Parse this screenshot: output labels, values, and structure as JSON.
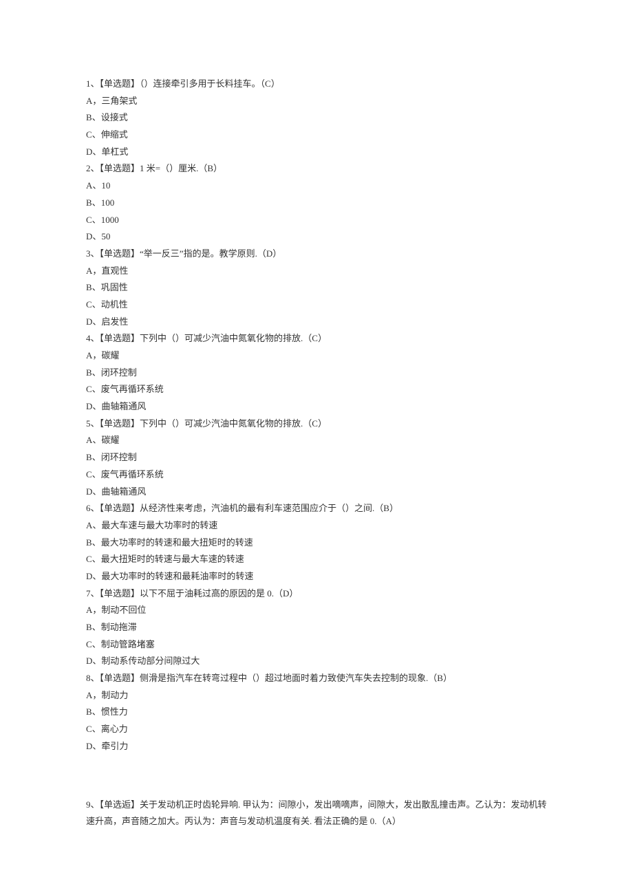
{
  "questions": [
    {
      "num": "1",
      "type": "【单选题】",
      "text": "（）连接牵引多用于长料挂车。",
      "answer": "（C）",
      "options": [
        {
          "label": "A",
          "sep": "，",
          "text": "三角架式"
        },
        {
          "label": "B",
          "sep": "、",
          "text": "设接式"
        },
        {
          "label": "C",
          "sep": "、",
          "text": "伸缩式"
        },
        {
          "label": "D",
          "sep": "、",
          "text": "单杠式"
        }
      ]
    },
    {
      "num": "2",
      "type": "【单选题】",
      "text": "1 米=（）厘米.",
      "answer": "（B）",
      "options": [
        {
          "label": "A",
          "sep": "、",
          "text": "10"
        },
        {
          "label": "B",
          "sep": "、",
          "text": "100"
        },
        {
          "label": "C",
          "sep": "、",
          "text": "1000"
        },
        {
          "label": "D",
          "sep": "、",
          "text": "50"
        }
      ]
    },
    {
      "num": "3",
      "type": "【单选题】",
      "text": "“举一反三”指的是。教学原则.",
      "answer": "（D）",
      "options": [
        {
          "label": "A",
          "sep": "，",
          "text": "直观性"
        },
        {
          "label": "B",
          "sep": "、",
          "text": "巩固性"
        },
        {
          "label": "C",
          "sep": "、",
          "text": "动机性"
        },
        {
          "label": "D",
          "sep": "、",
          "text": "启发性"
        }
      ]
    },
    {
      "num": "4",
      "type": "【单选题】",
      "text": "下列中（）可减少汽油中氮氧化物的排放.",
      "answer": "（C）",
      "options": [
        {
          "label": "A",
          "sep": "，",
          "text": "碳耀"
        },
        {
          "label": "B",
          "sep": "、",
          "text": "闭环控制"
        },
        {
          "label": "C",
          "sep": "、",
          "text": "废气再循环系统"
        },
        {
          "label": "D",
          "sep": "、",
          "text": "曲轴箱通风"
        }
      ]
    },
    {
      "num": "5",
      "type": "【单选题】",
      "text": "下列中（）可减少汽油中氮氧化物的排放.",
      "answer": "（C）",
      "options": [
        {
          "label": "A",
          "sep": "、",
          "text": "碳耀"
        },
        {
          "label": "B",
          "sep": "、",
          "text": "闭环控制"
        },
        {
          "label": "C",
          "sep": "、",
          "text": "废气再循环系统"
        },
        {
          "label": "D",
          "sep": "、",
          "text": "曲轴箱通风"
        }
      ]
    },
    {
      "num": "6",
      "type": "【单选题】",
      "text": "从经济性来考虑，汽油机的最有利车速范围应介于（）之间.",
      "answer": "（B）",
      "options": [
        {
          "label": "A",
          "sep": "、",
          "text": "最大车速与最大功率时的转速"
        },
        {
          "label": "B",
          "sep": "、",
          "text": "最大功率时的转速和最大扭矩时的转速"
        },
        {
          "label": "C",
          "sep": "、",
          "text": "最大扭矩时的转速与最大车速的转速"
        },
        {
          "label": "D",
          "sep": "、",
          "text": "最大功率时的转速和最耗油率时的转速"
        }
      ]
    },
    {
      "num": "7",
      "type": "【单选题】",
      "text": "以下不屈于油耗过高的原因的是 0.",
      "answer": "（D）",
      "options": [
        {
          "label": "A",
          "sep": "，",
          "text": "制动不回位"
        },
        {
          "label": "B",
          "sep": "、",
          "text": "制动拖滞"
        },
        {
          "label": "C",
          "sep": "、",
          "text": "制动管路堵塞"
        },
        {
          "label": "D",
          "sep": "、",
          "text": "制动系传动部分间隙过大"
        }
      ]
    },
    {
      "num": "8",
      "type": "【单选题】",
      "text": "侧滑是指汽车在转弯过程中（）超过地面时着力致使汽车失去控制的现象.",
      "answer": "（B）",
      "options": [
        {
          "label": "A",
          "sep": "，",
          "text": "制动力"
        },
        {
          "label": "B",
          "sep": "、",
          "text": "惯性力"
        },
        {
          "label": "C",
          "sep": "、",
          "text": "离心力"
        },
        {
          "label": "D",
          "sep": "、",
          "text": "牵引力"
        }
      ]
    }
  ],
  "question9": {
    "num": "9",
    "type": "【单选逅】",
    "text": "关于发动机正时齿轮异响. 甲认为：间隙小，发出嘀嘀声，间隙大，发出散乱撞击声。乙认为：发动机转速升高，声音随之加大。丙认为：声音与发动机温度有关. 看法正确的是 0.",
    "answer": "（A）"
  }
}
